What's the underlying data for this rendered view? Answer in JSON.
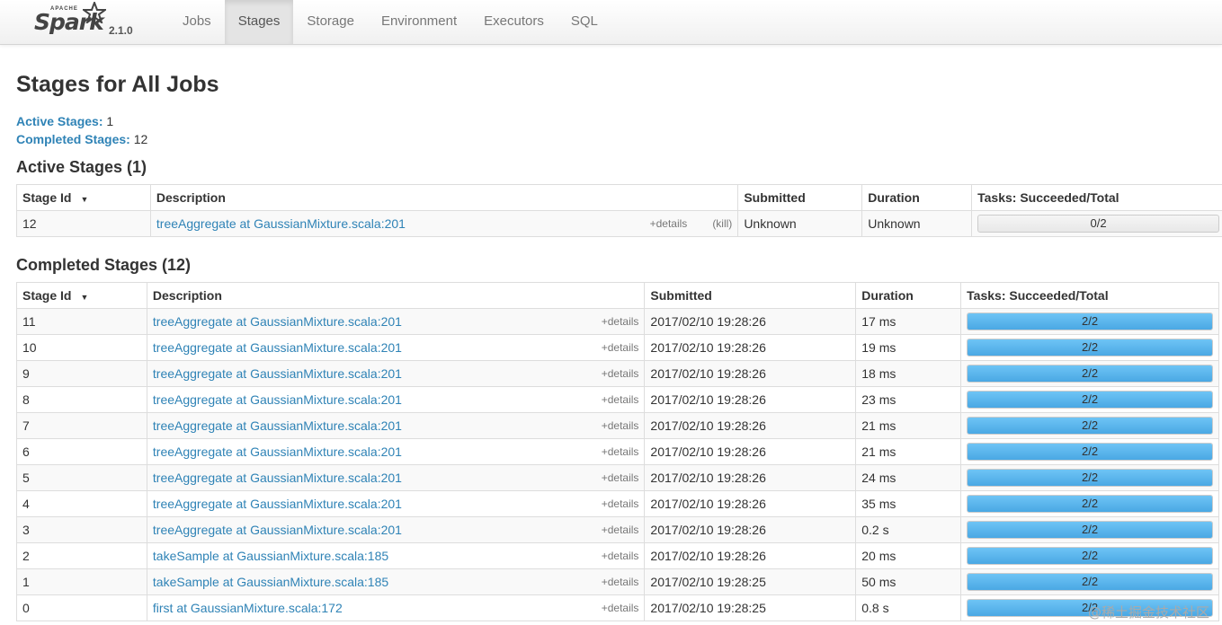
{
  "brand": {
    "apache": "APACHE",
    "name": "Spark",
    "version": "2.1.0"
  },
  "nav": {
    "tabs": [
      "Jobs",
      "Stages",
      "Storage",
      "Environment",
      "Executors",
      "SQL"
    ],
    "active": "Stages"
  },
  "page": {
    "title": "Stages for All Jobs",
    "active_label": "Active Stages:",
    "active_count": "1",
    "completed_label": "Completed Stages:",
    "completed_count": "12"
  },
  "active_table": {
    "heading": "Active Stages (1)",
    "headers": {
      "id": "Stage Id",
      "desc": "Description",
      "submitted": "Submitted",
      "duration": "Duration",
      "tasks": "Tasks: Succeeded/Total"
    },
    "rows": [
      {
        "id": "12",
        "desc": "treeAggregate at GaussianMixture.scala:201",
        "details": "+details",
        "kill": "(kill)",
        "submitted": "Unknown",
        "duration": "Unknown",
        "tasks": "0/2",
        "progress": 0
      }
    ]
  },
  "completed_table": {
    "heading": "Completed Stages (12)",
    "headers": {
      "id": "Stage Id",
      "desc": "Description",
      "submitted": "Submitted",
      "duration": "Duration",
      "tasks": "Tasks: Succeeded/Total"
    },
    "rows": [
      {
        "id": "11",
        "desc": "treeAggregate at GaussianMixture.scala:201",
        "details": "+details",
        "submitted": "2017/02/10 19:28:26",
        "duration": "17 ms",
        "tasks": "2/2",
        "progress": 1
      },
      {
        "id": "10",
        "desc": "treeAggregate at GaussianMixture.scala:201",
        "details": "+details",
        "submitted": "2017/02/10 19:28:26",
        "duration": "19 ms",
        "tasks": "2/2",
        "progress": 1
      },
      {
        "id": "9",
        "desc": "treeAggregate at GaussianMixture.scala:201",
        "details": "+details",
        "submitted": "2017/02/10 19:28:26",
        "duration": "18 ms",
        "tasks": "2/2",
        "progress": 1
      },
      {
        "id": "8",
        "desc": "treeAggregate at GaussianMixture.scala:201",
        "details": "+details",
        "submitted": "2017/02/10 19:28:26",
        "duration": "23 ms",
        "tasks": "2/2",
        "progress": 1
      },
      {
        "id": "7",
        "desc": "treeAggregate at GaussianMixture.scala:201",
        "details": "+details",
        "submitted": "2017/02/10 19:28:26",
        "duration": "21 ms",
        "tasks": "2/2",
        "progress": 1
      },
      {
        "id": "6",
        "desc": "treeAggregate at GaussianMixture.scala:201",
        "details": "+details",
        "submitted": "2017/02/10 19:28:26",
        "duration": "21 ms",
        "tasks": "2/2",
        "progress": 1
      },
      {
        "id": "5",
        "desc": "treeAggregate at GaussianMixture.scala:201",
        "details": "+details",
        "submitted": "2017/02/10 19:28:26",
        "duration": "24 ms",
        "tasks": "2/2",
        "progress": 1
      },
      {
        "id": "4",
        "desc": "treeAggregate at GaussianMixture.scala:201",
        "details": "+details",
        "submitted": "2017/02/10 19:28:26",
        "duration": "35 ms",
        "tasks": "2/2",
        "progress": 1
      },
      {
        "id": "3",
        "desc": "treeAggregate at GaussianMixture.scala:201",
        "details": "+details",
        "submitted": "2017/02/10 19:28:26",
        "duration": "0.2 s",
        "tasks": "2/2",
        "progress": 1
      },
      {
        "id": "2",
        "desc": "takeSample at GaussianMixture.scala:185",
        "details": "+details",
        "submitted": "2017/02/10 19:28:26",
        "duration": "20 ms",
        "tasks": "2/2",
        "progress": 1
      },
      {
        "id": "1",
        "desc": "takeSample at GaussianMixture.scala:185",
        "details": "+details",
        "submitted": "2017/02/10 19:28:25",
        "duration": "50 ms",
        "tasks": "2/2",
        "progress": 1
      },
      {
        "id": "0",
        "desc": "first at GaussianMixture.scala:172",
        "details": "+details",
        "submitted": "2017/02/10 19:28:25",
        "duration": "0.8 s",
        "tasks": "2/2",
        "progress": 1
      }
    ]
  },
  "watermark": "@稀土掘金技术社区",
  "colors": {
    "link": "#2f83b6",
    "progress_fill": "#4aa8e4"
  }
}
